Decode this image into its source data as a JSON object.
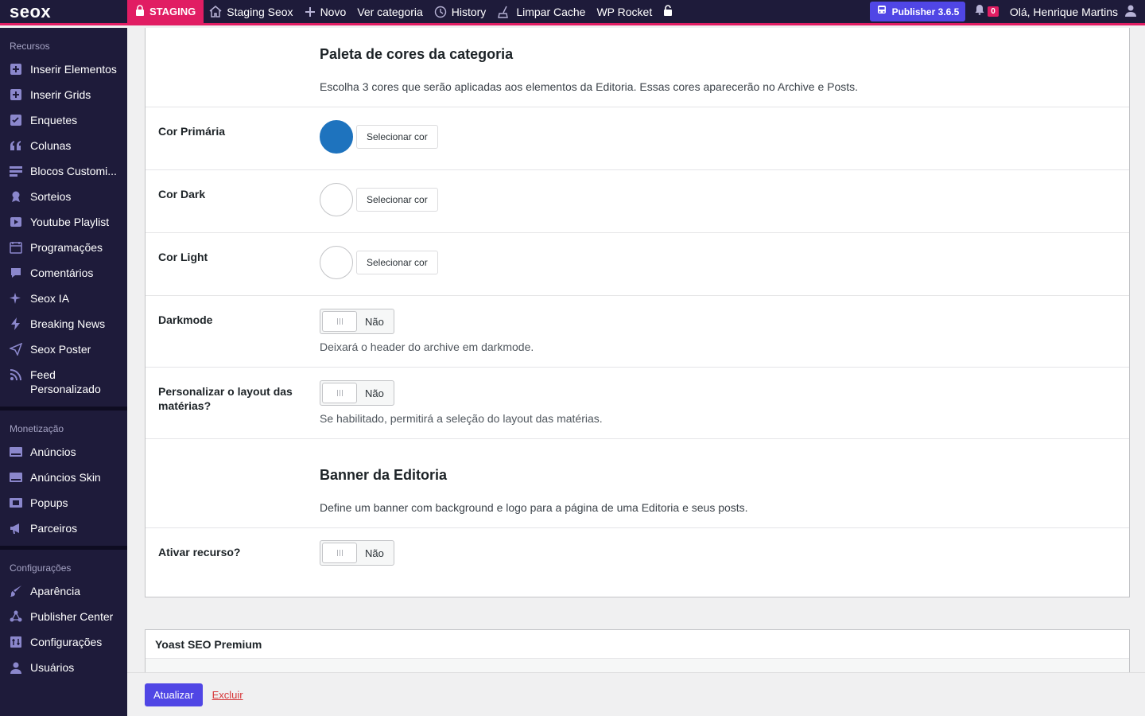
{
  "adminbar": {
    "logo": "seox",
    "staging_label": "STAGING",
    "site_name": "Staging Seox",
    "new_label": "Novo",
    "view_category": "Ver categoria",
    "history": "History",
    "clear_cache": "Limpar Cache",
    "wp_rocket": "WP Rocket",
    "publisher_badge": "Publisher 3.6.5",
    "notifications_count": "0",
    "greeting": "Olá, Henrique Martins"
  },
  "sidebar": {
    "recursos": {
      "heading": "Recursos",
      "items": [
        {
          "label": "Inserir Elementos",
          "icon": "plus-square-icon"
        },
        {
          "label": "Inserir Grids",
          "icon": "plus-square-icon"
        },
        {
          "label": "Enquetes",
          "icon": "poll-icon"
        },
        {
          "label": "Colunas",
          "icon": "quote-icon"
        },
        {
          "label": "Blocos Customi...",
          "icon": "blocks-icon"
        },
        {
          "label": "Sorteios",
          "icon": "award-icon"
        },
        {
          "label": "Youtube Playlist",
          "icon": "video-icon"
        },
        {
          "label": "Programações",
          "icon": "calendar-icon"
        },
        {
          "label": "Comentários",
          "icon": "comment-icon"
        },
        {
          "label": "Seox IA",
          "icon": "sparkle-icon"
        },
        {
          "label": "Breaking News",
          "icon": "bolt-icon"
        },
        {
          "label": "Seox Poster",
          "icon": "send-icon"
        },
        {
          "label": "Feed Personalizado",
          "icon": "rss-icon"
        }
      ]
    },
    "monetizacao": {
      "heading": "Monetização",
      "items": [
        {
          "label": "Anúncios",
          "icon": "ad-icon"
        },
        {
          "label": "Anúncios Skin",
          "icon": "ad-icon"
        },
        {
          "label": "Popups",
          "icon": "popup-icon"
        },
        {
          "label": "Parceiros",
          "icon": "megaphone-icon"
        }
      ]
    },
    "configuracoes": {
      "heading": "Configurações",
      "items": [
        {
          "label": "Aparência",
          "icon": "brush-icon"
        },
        {
          "label": "Publisher Center",
          "icon": "network-icon"
        },
        {
          "label": "Configurações",
          "icon": "settings-icon"
        },
        {
          "label": "Usuários",
          "icon": "user-icon"
        }
      ]
    }
  },
  "form": {
    "palette": {
      "title": "Paleta de cores da categoria",
      "description": "Escolha 3 cores que serão aplicadas aos elementos da Editoria. Essas cores aparecerão no Archive e Posts."
    },
    "colors": [
      {
        "label": "Cor Primária",
        "value": "#1e73be",
        "button": "Selecionar cor"
      },
      {
        "label": "Cor Dark",
        "value": "#ffffff",
        "button": "Selecionar cor"
      },
      {
        "label": "Cor Light",
        "value": "#ffffff",
        "button": "Selecionar cor"
      }
    ],
    "darkmode": {
      "label": "Darkmode",
      "state": "Não",
      "hint": "Deixará o header do archive em darkmode."
    },
    "layout": {
      "label": "Personalizar o layout das matérias?",
      "state": "Não",
      "hint": "Se habilitado, permitirá a seleção do layout das matérias."
    },
    "banner": {
      "title": "Banner da Editoria",
      "description": "Define um banner com background e logo para a página de uma Editoria e seus posts."
    },
    "activate": {
      "label": "Ativar recurso?",
      "state": "Não"
    }
  },
  "yoast": {
    "title": "Yoast SEO Premium"
  },
  "footer": {
    "update": "Atualizar",
    "delete": "Excluir"
  }
}
